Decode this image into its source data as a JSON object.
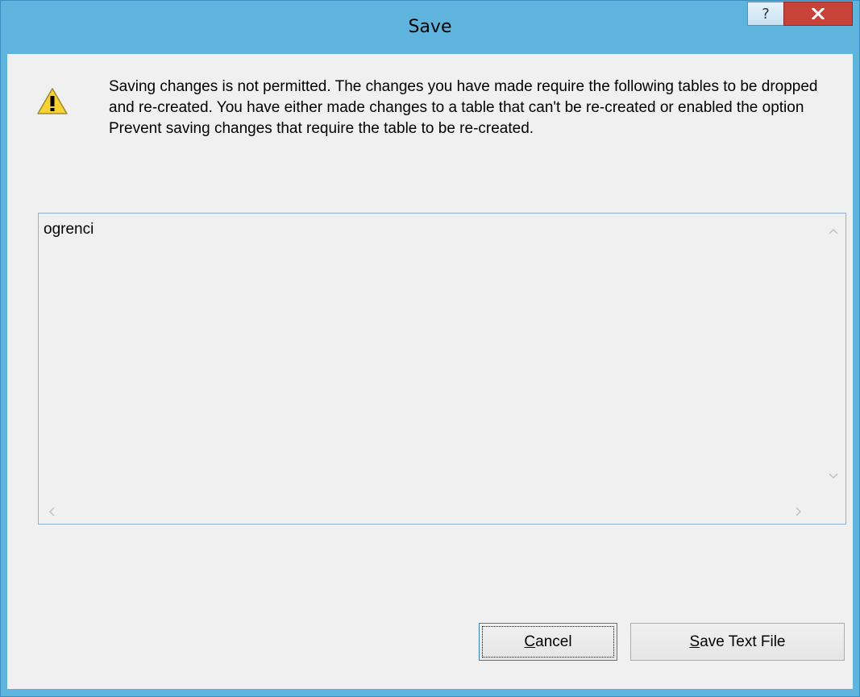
{
  "window": {
    "title": "Save"
  },
  "title_buttons": {
    "help": "?"
  },
  "message": {
    "text": "Saving changes is not permitted. The changes you have made require the following tables to be dropped and re-created. You have either made changes to a table that can't be re-created or enabled the option Prevent saving changes that require the table to be re-created.",
    "icon": "warning-icon"
  },
  "tables_list": {
    "items": [
      "ogrenci"
    ]
  },
  "buttons": {
    "cancel_label": "Cancel",
    "save_text_file_label": "Save Text File"
  },
  "colors": {
    "titlebar": "#5eb4dd",
    "close_button": "#c74239",
    "client": "#f0f0f0",
    "listbox_border": "#8fb1d6"
  }
}
